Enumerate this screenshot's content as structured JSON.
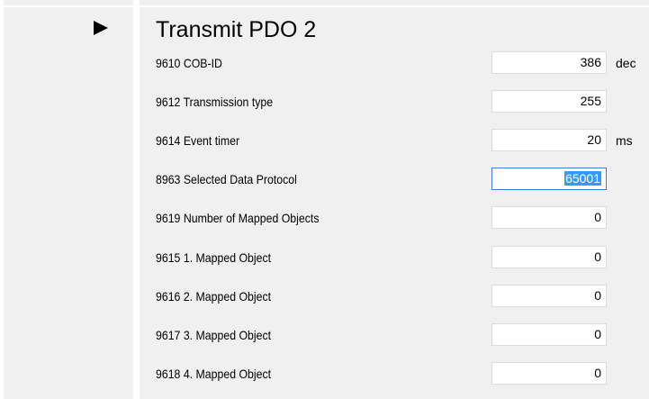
{
  "section": {
    "title": "Transmit PDO 2",
    "expand_icon": "triangle-right-icon"
  },
  "params": [
    {
      "label": "9610 COB-ID",
      "value": "386",
      "unit": "dec"
    },
    {
      "label": "9612 Transmission type",
      "value": "255",
      "unit": ""
    },
    {
      "label": "9614 Event timer",
      "value": "20",
      "unit": "ms"
    },
    {
      "label": "8963 Selected Data Protocol",
      "value": "65001",
      "unit": "",
      "selected": true
    },
    {
      "label": "9619 Number of Mapped Objects",
      "value": "0",
      "unit": ""
    },
    {
      "label": "9615 1. Mapped Object",
      "value": "0",
      "unit": ""
    },
    {
      "label": "9616 2. Mapped Object",
      "value": "0",
      "unit": ""
    },
    {
      "label": "9617 3. Mapped Object",
      "value": "0",
      "unit": ""
    },
    {
      "label": "9618 4. Mapped Object",
      "value": "0",
      "unit": ""
    }
  ],
  "colors": {
    "panel_bg": "#f0f0f0",
    "input_border": "#dcdcdc",
    "focus_border": "#3c7fd4",
    "selection": "#3399ff"
  }
}
